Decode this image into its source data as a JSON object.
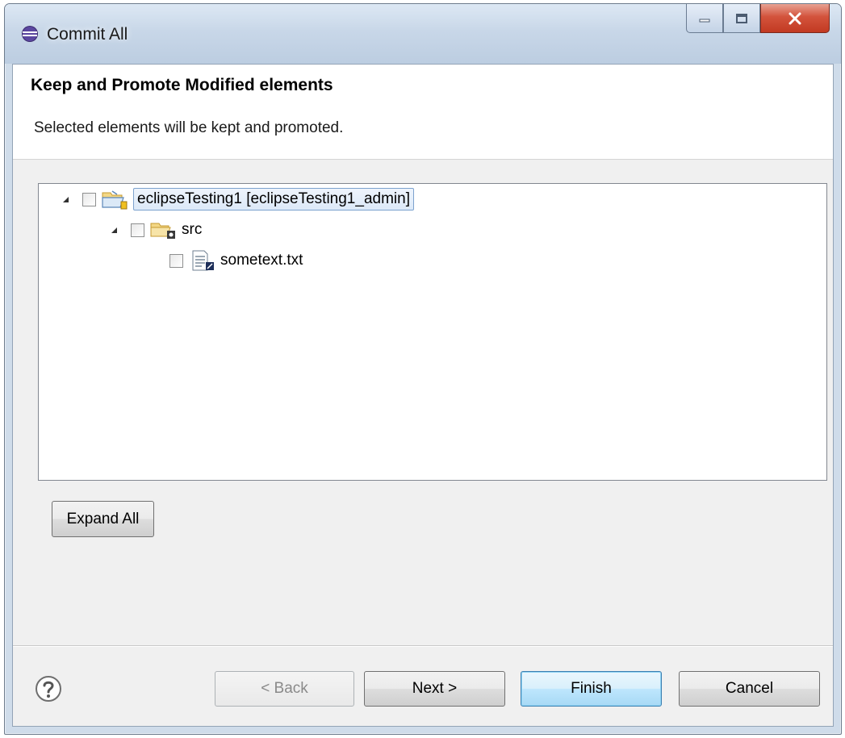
{
  "window": {
    "title": "Commit All",
    "app_icon": "eclipse-icon",
    "controls": [
      "minimize-icon",
      "maximize-icon",
      "close-icon"
    ]
  },
  "banner": {
    "title": "Keep and Promote Modified elements",
    "description": "Selected elements will be kept and promoted."
  },
  "tree": {
    "nodes": [
      {
        "label": "eclipseTesting1 [eclipseTesting1_admin]",
        "icon": "project-folder-icon",
        "expanded": true,
        "checked": false,
        "selected": true
      },
      {
        "label": "src",
        "icon": "package-folder-icon",
        "expanded": true,
        "checked": false,
        "selected": false
      },
      {
        "label": "sometext.txt",
        "icon": "text-file-icon",
        "expanded": false,
        "checked": false,
        "selected": false
      }
    ]
  },
  "buttons": {
    "expand_all": "Expand All",
    "back": "< Back",
    "next": "Next >",
    "finish": "Finish",
    "cancel": "Cancel"
  },
  "colors": {
    "accent": "#3c7fb1",
    "selection": "#dce9f8"
  }
}
